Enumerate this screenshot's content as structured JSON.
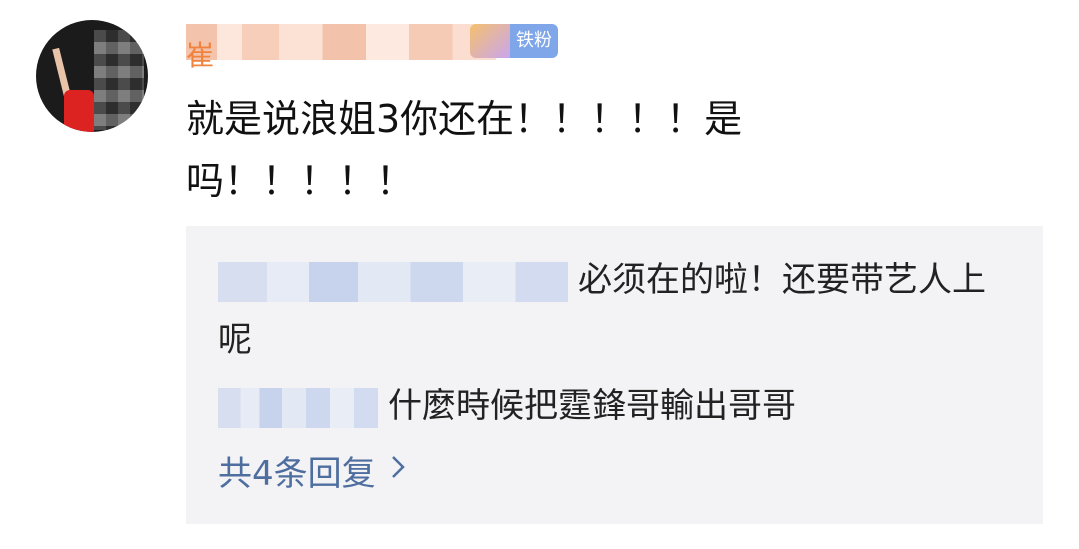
{
  "comment": {
    "username_initial": "崔",
    "fan_badge_label": "铁粉",
    "text": "就是说浪姐3你还在！！！！！是\n吗！！！！！"
  },
  "replies": [
    {
      "text": "必须在的啦！还要带艺人上呢"
    },
    {
      "text": "什麼時候把霆鋒哥輸出哥哥"
    }
  ],
  "reply_count_label": "共4条回复",
  "chevron_icon": "chevron-right-icon",
  "colors": {
    "username": "#f0843f",
    "link": "#4e6e9f",
    "reply_bg": "#f3f3f5",
    "badge": "#7fa6e8"
  }
}
